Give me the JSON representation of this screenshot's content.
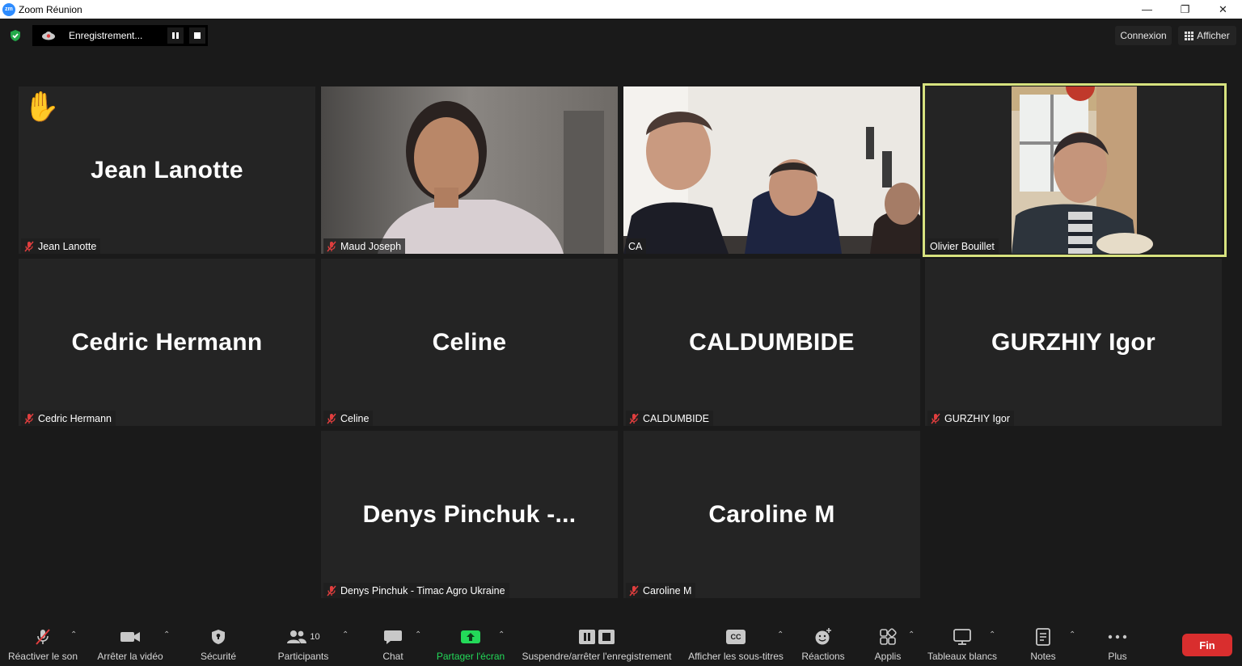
{
  "window": {
    "app_icon_text": "zm",
    "title": "Zoom Réunion",
    "controls": {
      "minimize": "—",
      "restore": "❐",
      "close": "✕"
    }
  },
  "topbar": {
    "recording_label": "Enregistrement...",
    "connexion_label": "Connexion",
    "view_label": "Afficher"
  },
  "participants": [
    {
      "center_name": "Jean Lanotte",
      "tag": "Jean Lanotte",
      "muted": true,
      "hand_raised": true,
      "video": false
    },
    {
      "center_name": "",
      "tag": "Maud Joseph",
      "muted": true,
      "video": true
    },
    {
      "center_name": "",
      "tag": "CA",
      "muted": false,
      "video": true
    },
    {
      "center_name": "",
      "tag": "Olivier Bouillet",
      "muted": false,
      "video": true,
      "active_speaker": true
    },
    {
      "center_name": "Cedric Hermann",
      "tag": "Cedric Hermann",
      "muted": true,
      "video": false
    },
    {
      "center_name": "Celine",
      "tag": "Celine",
      "muted": true,
      "video": false
    },
    {
      "center_name": "CALDUMBIDE",
      "tag": "CALDUMBIDE",
      "muted": true,
      "video": false
    },
    {
      "center_name": "GURZHIY Igor",
      "tag": "GURZHIY Igor",
      "muted": true,
      "video": false
    },
    {
      "center_name": "Denys Pinchuk -...",
      "tag": "Denys Pinchuk - Timac Agro Ukraine",
      "muted": true,
      "video": false
    },
    {
      "center_name": "Caroline M",
      "tag": "Caroline M",
      "muted": true,
      "video": false
    }
  ],
  "hand_emoji": "✋",
  "toolbar": {
    "unmute": "Réactiver le son",
    "stop_video": "Arrêter la vidéo",
    "security": "Sécurité",
    "participants": "Participants",
    "participants_count": "10",
    "chat": "Chat",
    "share_screen": "Partager l'écran",
    "pause_recording": "Suspendre/arrêter l'enregistrement",
    "captions": "Afficher les sous-titres",
    "captions_icon": "CC",
    "reactions": "Réactions",
    "apps": "Applis",
    "whiteboards": "Tableaux blancs",
    "notes": "Notes",
    "more": "Plus",
    "end": "Fin"
  },
  "colors": {
    "background": "#1a1a1a",
    "tile": "#242424",
    "active_speaker_border": "#d7e27f",
    "end_button": "#d92e2e",
    "share_green": "#23d959",
    "mute_red": "#e03e3e",
    "shield_green": "#23a94a"
  }
}
